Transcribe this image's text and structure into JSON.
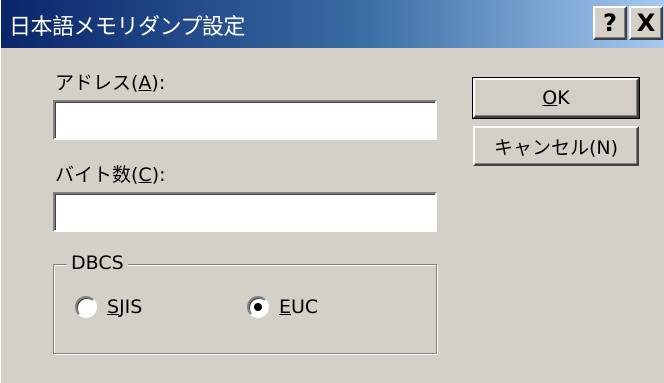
{
  "window": {
    "title": "日本語メモリダンプ設定",
    "help_button": "?",
    "close_button": "X"
  },
  "address": {
    "label_prefix": "アドレス(",
    "label_key": "A",
    "label_suffix": "):",
    "value": ""
  },
  "bytes": {
    "label_prefix": "バイト数(",
    "label_key": "C",
    "label_suffix": "):",
    "value": ""
  },
  "dbcs": {
    "group_label": "DBCS",
    "options": [
      {
        "key": "S",
        "rest": "JIS",
        "checked": false
      },
      {
        "key": "E",
        "rest": "UC",
        "checked": true
      }
    ]
  },
  "buttons": {
    "ok_key": "O",
    "ok_rest": "K",
    "cancel": "キャンセル(N)"
  }
}
